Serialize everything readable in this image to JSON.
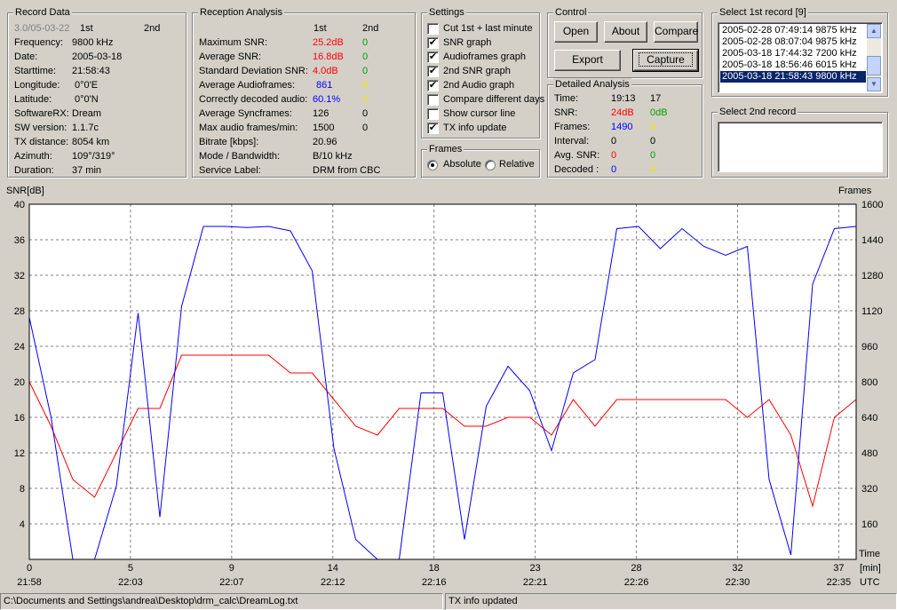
{
  "record_data": {
    "title": "Record Data",
    "version": "3.0/05-03-22",
    "col1": "1st",
    "col2": "2nd",
    "rows": [
      {
        "label": "Frequency:",
        "value": "9800 kHz"
      },
      {
        "label": "Date:",
        "value": "2005-03-18"
      },
      {
        "label": "Starttime:",
        "value": "21:58:43"
      },
      {
        "label": "Longitude:",
        "value": "0°0'E"
      },
      {
        "label": "Latitude:",
        "value": "0°0'N"
      },
      {
        "label": "SoftwareRX:",
        "value": "Dream"
      },
      {
        "label": "SW version:",
        "value": "1.1.7c"
      },
      {
        "label": "TX distance:",
        "value": "8054 km"
      },
      {
        "label": "Azimuth:",
        "value": "109°/319°"
      },
      {
        "label": "Duration:",
        "value": "37 min"
      }
    ]
  },
  "reception": {
    "title": "Reception Analysis",
    "col1": "1st",
    "col2": "2nd",
    "rows": [
      {
        "label": "Maximum SNR:",
        "v1": "25.2dB",
        "v2": "0"
      },
      {
        "label": "Average SNR:",
        "v1": "16.8dB",
        "v2": "0"
      },
      {
        "label": "Standard Deviation SNR:",
        "v1": "4.0dB",
        "v2": "0"
      },
      {
        "label": "Average Audioframes:",
        "v1": "861",
        "v2": "0"
      },
      {
        "label": "Correctly decoded audio:",
        "v1": "60.1%",
        "v2": "0"
      },
      {
        "label": "Average Syncframes:",
        "v1": "126",
        "v2": "0"
      },
      {
        "label": "Max audio frames/min:",
        "v1": "1500",
        "v2": "0"
      },
      {
        "label": "Bitrate [kbps]:",
        "v1": "20.96",
        "v2": ""
      },
      {
        "label": "Mode / Bandwidth:",
        "v1": "B/10 kHz",
        "v2": ""
      },
      {
        "label": "Service Label:",
        "v1": "DRM from CBC",
        "v2": ""
      }
    ]
  },
  "settings": {
    "title": "Settings",
    "items": [
      {
        "label": "Cut 1st + last minute",
        "checked": false
      },
      {
        "label": "SNR graph",
        "checked": true
      },
      {
        "label": "Audioframes graph",
        "checked": true
      },
      {
        "label": "2nd SNR graph",
        "checked": true
      },
      {
        "label": "2nd Audio graph",
        "checked": true
      },
      {
        "label": "Compare different days",
        "checked": false
      },
      {
        "label": "Show cursor line",
        "checked": false
      },
      {
        "label": "TX info update",
        "checked": true
      }
    ]
  },
  "frames": {
    "title": "Frames",
    "absolute": "Absolute",
    "relative": "Relative"
  },
  "control": {
    "title": "Control",
    "open": "Open",
    "about": "About",
    "compare": "Compare",
    "export": "Export",
    "capture": "Capture"
  },
  "detailed": {
    "title": "Detailed Analysis",
    "rows": [
      {
        "label": "Time:",
        "v1": "19:13",
        "v2": "17"
      },
      {
        "label": "SNR:",
        "v1": "24dB",
        "v2": "0dB"
      },
      {
        "label": "Frames:",
        "v1": "1490",
        "v2": "0"
      },
      {
        "label": "Interval:",
        "v1": "0",
        "v2": "0"
      },
      {
        "label": "Avg. SNR:",
        "v1": "0",
        "v2": "0"
      },
      {
        "label": "Decoded :",
        "v1": "0",
        "v2": "0"
      }
    ]
  },
  "select1": {
    "title": "Select 1st record [9]",
    "items": [
      "2005-02-28 07:49:14 9875 kHz",
      "2005-02-28 08:07:04 9875 kHz",
      "2005-03-18 17:44:32 7200 kHz",
      "2005-03-18 18:56:46 6015 kHz",
      "2005-03-18 21:58:43 9800 kHz"
    ],
    "selected": 4
  },
  "select2": {
    "title": "Select 2nd record"
  },
  "status": {
    "path": "C:\\Documents and Settings\\andrea\\Desktop\\drm_calc\\DreamLog.txt",
    "message": "TX info updated"
  },
  "chart_data": {
    "type": "line",
    "ylabel_left": "SNR[dB]",
    "ylabel_right": "Frames",
    "xlabel_unit": "[min]",
    "xlabel_time": "Time",
    "xlabel_utc": "UTC",
    "ylim_left": [
      0,
      40
    ],
    "ylim_right": [
      0,
      1600
    ],
    "xlim": [
      0,
      38
    ],
    "grid": true,
    "y_ticks_left": [
      "40",
      "36",
      "32",
      "28",
      "24",
      "20",
      "16",
      "12",
      "8",
      "4"
    ],
    "y_ticks_right": [
      "1600",
      "1440",
      "1280",
      "1120",
      "960",
      "800",
      "640",
      "480",
      "320",
      "160"
    ],
    "x_ticks_min": [
      "0",
      "5",
      "9",
      "14",
      "18",
      "23",
      "28",
      "32",
      "37"
    ],
    "x_ticks_utc": [
      "21:58",
      "22:03",
      "22:07",
      "22:12",
      "22:16",
      "22:21",
      "22:26",
      "22:30",
      "22:35"
    ],
    "x_tick_values": [
      0,
      4.65,
      9.3,
      13.95,
      18.6,
      23.25,
      27.9,
      32.55,
      37.2
    ],
    "series": [
      {
        "name": "SNR",
        "color": "#ff0000",
        "axis": "left",
        "x": [
          0,
          1,
          2,
          3,
          4,
          5,
          6,
          7,
          8,
          9,
          10,
          11,
          12,
          13,
          14,
          15,
          16,
          17,
          18,
          19,
          20,
          21,
          22,
          23,
          24,
          25,
          26,
          27,
          28,
          29,
          30,
          31,
          32,
          33,
          34,
          35,
          36,
          37,
          38
        ],
        "values": [
          20,
          15,
          9,
          7,
          12,
          17,
          17,
          23,
          23,
          23,
          23,
          23,
          21,
          21,
          18,
          15,
          14,
          17,
          17,
          17,
          15,
          15,
          16,
          16,
          14,
          18,
          15,
          18,
          18,
          18,
          18,
          18,
          18,
          16,
          18,
          14,
          6,
          16,
          18
        ]
      },
      {
        "name": "Audioframes",
        "color": "#0000ff",
        "axis": "right",
        "x": [
          0,
          1,
          2,
          3,
          4,
          5,
          6,
          7,
          8,
          9,
          10,
          11,
          12,
          13,
          14,
          15,
          16,
          17,
          18,
          19,
          20,
          21,
          22,
          23,
          24,
          25,
          26,
          27,
          28,
          29,
          30,
          31,
          32,
          33,
          34,
          35,
          36,
          37,
          38
        ],
        "values": [
          1090,
          640,
          0,
          0,
          330,
          1110,
          190,
          1140,
          1500,
          1500,
          1495,
          1500,
          1480,
          1300,
          500,
          90,
          0,
          0,
          750,
          750,
          90,
          690,
          870,
          760,
          490,
          840,
          900,
          1490,
          1500,
          1400,
          1490,
          1410,
          1370,
          1410,
          360,
          20,
          1240,
          1490,
          1500
        ]
      }
    ]
  }
}
